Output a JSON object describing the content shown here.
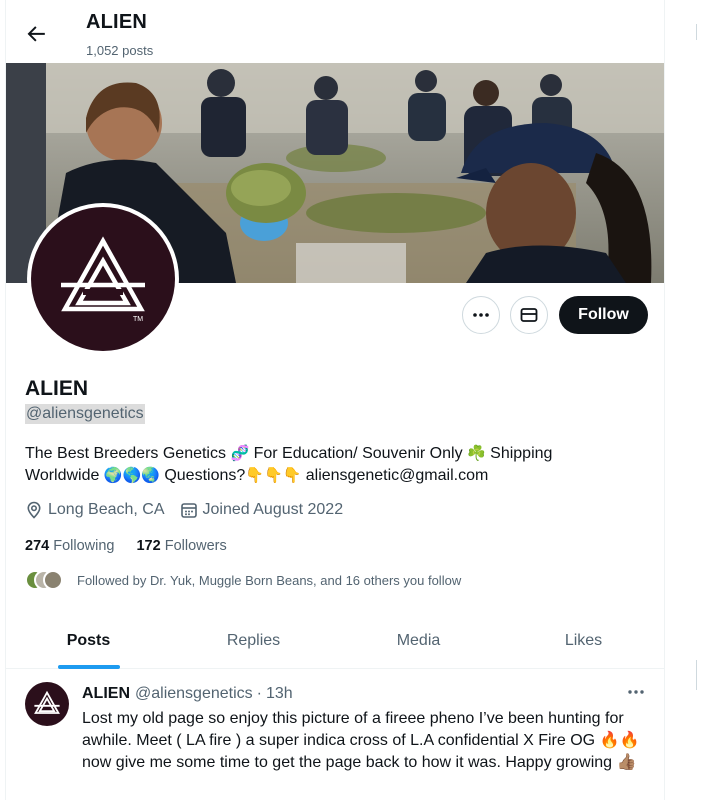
{
  "header": {
    "title": "ALIEN",
    "post_count": "1,052 posts"
  },
  "actions": {
    "more_icon": "ellipsis-icon",
    "message_icon": "envelope-icon",
    "follow_label": "Follow"
  },
  "profile": {
    "name": "ALIEN",
    "handle": "@aliensgenetics",
    "bio_part1": "The Best Breeders Genetics ",
    "bio_emoji1": "🧬",
    "bio_part2": " For Education/ Souvenir Only ",
    "bio_emoji2": "☘️",
    "bio_part3": " Shipping Worldwide ",
    "bio_emoji3": "🌍🌎🌏",
    "bio_part4": " Questions?",
    "bio_emoji4": "👇👇👇",
    "bio_email": "  aliensgenetic@gmail.com",
    "location": "Long Beach, CA",
    "joined": "Joined August 2022",
    "following_count": "274",
    "following_label": "Following",
    "followers_count": "172",
    "followers_label": "Followers",
    "followed_by": "Followed by Dr. Yuk, Muggle Born Beans, and 16 others you follow"
  },
  "tabs": [
    {
      "label": "Posts",
      "active": true
    },
    {
      "label": "Replies",
      "active": false
    },
    {
      "label": "Media",
      "active": false
    },
    {
      "label": "Likes",
      "active": false
    }
  ],
  "tweet": {
    "name": "ALIEN",
    "handle": "@aliensgenetics",
    "separator": "·",
    "time": "13h",
    "text": "Lost my old page so enjoy this picture of a fireee pheno I’ve been hunting for awhile. Meet ( LA fire ) a super indica cross of L.A confidential X Fire OG ",
    "emoji1": "🔥🔥",
    "text2": " now give me some time to get the page back to how it was. Happy growing ",
    "emoji2": "👍🏽"
  },
  "colors": {
    "accent": "#1d9bf0",
    "follow_bg": "#0f1419",
    "avatar_bg": "#2b0f1b",
    "muted_text": "#536471"
  }
}
